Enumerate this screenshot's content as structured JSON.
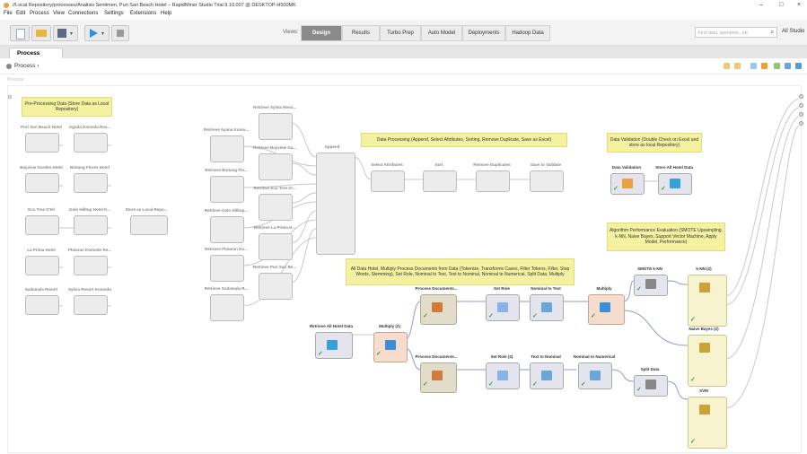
{
  "window": {
    "title": "//Local Repository/processes/Analisis Sentimen, Puri Sari Beach Hotel – RapidMiner Studio Trial 9.10.007 @ DESKTOP-H500MK",
    "minimize": "–",
    "maximize": "□",
    "close": "×"
  },
  "menu": [
    "File",
    "Edit",
    "Process",
    "View",
    "Connections",
    "Settings",
    "Extensions",
    "Help"
  ],
  "views": {
    "label": "Views:",
    "tabs": [
      "Design",
      "Results",
      "Turbo Prep",
      "Auto Model",
      "Deployments",
      "Hadoop Data"
    ],
    "active": "Design"
  },
  "search": {
    "placeholder": "Find data, operators...etc"
  },
  "studio_label": "All Studio",
  "process_tab": "Process",
  "breadcrumb": "Process ›",
  "canvas_label": "Process",
  "colors": {
    "note": "#f4f2a0",
    "active_tab": "#8a8a8a",
    "wire": "#c9c9c9",
    "wire_blue": "#8c9ccd",
    "wire_purple": "#a98ac9",
    "check": "#3a9d3a"
  },
  "notes": {
    "preprocessing": "Pre-Processing Data (Store Data as Local Repository)",
    "processing": "Data Processing (Append, Select Attributes, Sorting, Remove Duplicate, Save as Excel)",
    "validation": "Data Validation (Double Check on Excel and store as local Repository)",
    "all_hotel": "All Data Hotel, Multiply Process Documents from Data (Tokenize, Transforms Cases, Filter Tokens, Filter, Stop Words, Stemming), Set Role, Nominal to Text, Text to Nominal, Nominal to Numerical, Split Data, Multiply",
    "algorithm": "Algorithm Performance Evaluation (SMOTE Upsampling, k-NN, Naive Bayes, Support Vector Machine, Apply Model, Performance)"
  },
  "ops": {
    "puri_sari": "Puri Sari Beach Hotel",
    "agoda_kemoda": "Agoda Kemoda Res...",
    "bayview": "Bayview Garden Hotel",
    "bintang_flores": "Bintang Flores Hotel",
    "eco_tree": "Eco Tree O'tel",
    "golo_hilltop": "Golo Hilltop Hotel K...",
    "store_local": "Store as Local Repo...",
    "la_prima": "La Prima Hotel",
    "plataran": "Plataran Komodo Re...",
    "sudamala": "Sudamala Resort",
    "sylvia": "Sylvia Resort Komodo",
    "r_sylvia": "Retrieve Sylvia Reso...",
    "r_agoda": "Retrieve Ayana Komo...",
    "r_bayview": "Retrieve Bayview Ga...",
    "r_bintang": "Retrieve Bintang Flo...",
    "r_eco": "Retrieve Eco Tree O'...",
    "r_golo": "Retrieve Golo Hilltop...",
    "r_laprima": "Retrieve La Prima H...",
    "r_plataran": "Retrieve Plataran Ko...",
    "r_puri": "Retrieve Puri Sari Be...",
    "r_sudamala": "Retrieve Sudamala R...",
    "append": "Append",
    "select_attr": "Select Attributes",
    "sort": "Sort",
    "remove_dup": "Remove Duplicates",
    "save_validate": "Save to Validate",
    "data_validation": "Data Validation",
    "store_all": "Store All Hotel Data",
    "retrieve_all": "Retrieve All Hotel Data",
    "multiply2": "Multiply (2)",
    "pd1": "Process Documents...",
    "pd2": "Process Documents...",
    "set_role": "Set Role",
    "set_role2": "Set Role (2)",
    "nom_text": "Nominal to Text",
    "text_nom": "Text to Nominal",
    "nom_num": "Nominal to Numerical",
    "multiply": "Multiply",
    "smote": "SMOTE k-NN",
    "split": "Split Data",
    "knn": "k-NN (2)",
    "naive": "Naive Bayes (2)",
    "svm": "SVM"
  }
}
